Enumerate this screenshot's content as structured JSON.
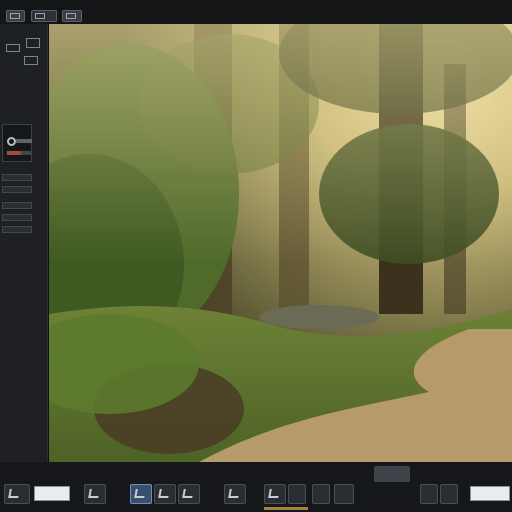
{
  "app": {
    "title": ""
  },
  "topbar": {
    "buttons": [
      "mode-button-1",
      "mode-button-2",
      "mode-button-3"
    ]
  },
  "sidebar": {
    "icons": [
      "layers-icon",
      "camera-icon",
      "terrain-icon",
      "light-icon",
      "material-icon",
      "list-icon"
    ],
    "meter_fraction": 0.6
  },
  "viewport": {
    "scene": "forest-render",
    "colors": {
      "sky": "#d8c88a",
      "fog": "#b7a56a",
      "foliage": "#4f6a2a",
      "path": "#b79a6a",
      "grass": "#5f7b2d"
    }
  },
  "toolbar": {
    "tools": [
      "select-tool",
      "move-tool",
      "rotate-tool",
      "scale-tool",
      "paint-tool",
      "sculpt-tool",
      "measure-tool"
    ],
    "selected_tool": "rotate-tool"
  },
  "theme": {
    "accent": "#6d8fbf",
    "bg": "#16171a"
  }
}
